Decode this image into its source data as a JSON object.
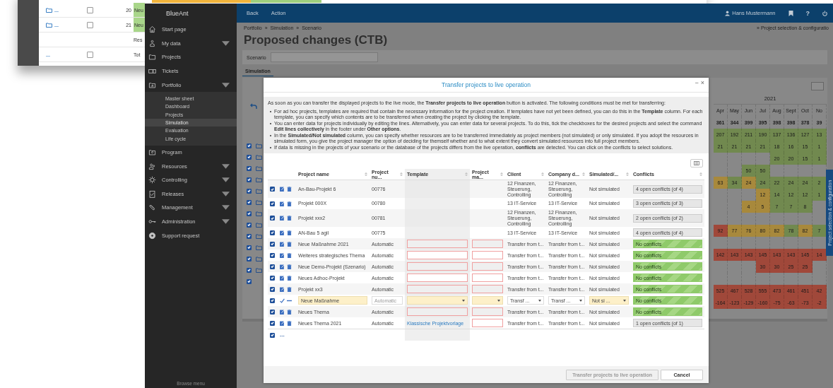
{
  "background_window": {
    "rows": [
      {
        "more": "...",
        "checked": false,
        "number": "20",
        "name": "Neu"
      },
      {
        "more": "...",
        "checked": false,
        "number": "21",
        "name": "Neu"
      }
    ],
    "result_label": "Res",
    "total": {
      "more": "...",
      "checked": false,
      "label": "Tot"
    }
  },
  "sidebar": {
    "logo": "BlueAnt",
    "items": [
      {
        "label": "Start page",
        "expandable": false
      },
      {
        "label": "My data",
        "expandable": true
      },
      {
        "label": "Projects",
        "expandable": false
      },
      {
        "label": "Tickets",
        "expandable": false
      },
      {
        "label": "Portfolio",
        "expandable": true,
        "children": [
          {
            "label": "Master sheet",
            "selected": false
          },
          {
            "label": "Dashboard",
            "selected": false
          },
          {
            "label": "Projects",
            "selected": false
          },
          {
            "label": "Simulation",
            "selected": true
          },
          {
            "label": "Evaluation",
            "selected": false
          },
          {
            "label": "Life cycle",
            "selected": false
          }
        ]
      },
      {
        "label": "Program",
        "expandable": false
      },
      {
        "label": "Resources",
        "expandable": true
      },
      {
        "label": "Controlling",
        "expandable": true
      },
      {
        "label": "Releases",
        "expandable": true
      },
      {
        "label": "Management",
        "expandable": true
      },
      {
        "label": "Administration",
        "expandable": true
      },
      {
        "label": "Support request",
        "expandable": false
      }
    ],
    "footer": "Browse menu"
  },
  "topbar": {
    "buttons": [
      "Back",
      "Action"
    ],
    "user": "Hans Mustermann",
    "help": "?"
  },
  "breadcrumb": {
    "items": [
      "Portfolio",
      "Simulation",
      "Scenario"
    ],
    "separator": "»"
  },
  "config_link": "» Project selection & configuratio",
  "title": "Proposed changes (CTB)",
  "filter": {
    "label": "Scenario"
  },
  "tabs": [
    {
      "label": "Simulation",
      "selected": true
    }
  ],
  "side_tab": "Project selection & configuration",
  "grid": {
    "rows": [
      {
        "checked": true
      },
      {
        "checked": true
      },
      {
        "checked": true
      },
      {
        "checked": true
      },
      {
        "checked": true
      },
      {
        "checked": true
      },
      {
        "checked": true
      },
      {
        "checked": true
      },
      {
        "checked": true
      },
      {
        "checked": true
      },
      {
        "checked": true
      },
      {
        "checked": true
      }
    ],
    "footer": {
      "checked": true
    }
  },
  "calendar": {
    "year": "2021",
    "months": [
      "Apr",
      "May",
      "Jun",
      "Jul",
      "Aug",
      "Sept",
      "Oct",
      "No"
    ],
    "rows": [
      [
        {
          "text": "361"
        },
        {
          "text": "344"
        },
        {
          "text": "399"
        },
        {
          "text": "395"
        },
        {
          "text": "398"
        },
        {
          "text": "398"
        },
        {
          "text": "378"
        },
        {
          "text": "39"
        }
      ],
      [
        {
          "text": "207",
          "color": "#71894f"
        },
        {
          "text": "192",
          "color": "#71894f"
        },
        {
          "text": "211",
          "color": "#71894f"
        },
        {
          "text": "190",
          "color": "#71894f"
        },
        {
          "text": "137",
          "color": "#71894f"
        },
        {
          "text": "136",
          "color": "#71894f"
        },
        {
          "text": "127",
          "color": "#71894f"
        },
        {
          "text": "13",
          "color": "#71894f"
        }
      ],
      [
        {
          "text": "21",
          "color": "#71894f"
        },
        {
          "text": "21",
          "color": "#71894f"
        },
        {
          "text": "21",
          "color": "#71894f"
        },
        {
          "text": "21",
          "color": "#71894f"
        },
        {
          "text": "18",
          "color": "#71894f"
        },
        {
          "text": "16",
          "color": "#71894f"
        },
        {
          "text": "15",
          "color": "#71894f"
        },
        {
          "text": "1",
          "color": "#71894f"
        }
      ],
      [
        null,
        null,
        null,
        null,
        {
          "text": "20",
          "color": "#71894f"
        },
        {
          "text": "20",
          "color": "#71894f"
        },
        {
          "text": "15",
          "color": "#71894f"
        },
        {
          "text": "1",
          "color": "#71894f"
        }
      ],
      [
        null,
        null,
        {
          "text": "50",
          "color": "#71894f"
        },
        {
          "text": "50",
          "color": "#71894f"
        },
        null,
        null,
        null,
        null
      ],
      [
        {
          "text": "63",
          "color": "#a8893c"
        },
        {
          "text": "34",
          "color": "#71894f"
        },
        {
          "text": "24",
          "color": "#a8893c"
        },
        {
          "text": "24",
          "color": "#71894f"
        },
        {
          "text": "22",
          "color": "#71894f"
        },
        {
          "text": "24",
          "color": "#71894f"
        },
        {
          "text": "24",
          "color": "#71894f"
        },
        {
          "text": "2",
          "color": "#71894f"
        }
      ],
      [
        null,
        null,
        null,
        {
          "text": "12",
          "color": "#a8893c"
        },
        {
          "text": "14",
          "color": "#71894f"
        },
        {
          "text": "12",
          "color": "#71894f"
        },
        {
          "text": "12",
          "color": "#71894f"
        },
        {
          "text": "1",
          "color": "#71894f"
        }
      ],
      [
        null,
        null,
        {
          "text": "4",
          "color": "#a8893c"
        },
        {
          "text": "5",
          "color": "#a8893c"
        },
        {
          "text": "7",
          "color": "#71894f"
        },
        {
          "text": "7",
          "color": "#71894f"
        },
        {
          "text": "8",
          "color": "#71894f"
        },
        null
      ],
      [
        null,
        null,
        null,
        null,
        null,
        null,
        null,
        null
      ],
      [
        {
          "text": "92",
          "color": "#a0483a"
        },
        {
          "text": "77",
          "color": "#a8893c"
        },
        {
          "text": "76",
          "color": "#a8893c"
        },
        {
          "text": "80",
          "color": "#a8893c"
        },
        {
          "text": "82",
          "color": "#a8893c"
        },
        {
          "text": "78",
          "color": "#71894f"
        },
        {
          "text": "82",
          "color": "#a8893c"
        },
        {
          "text": "7",
          "color": "#71894f"
        }
      ],
      [
        null,
        null,
        null,
        null,
        null,
        null,
        null,
        null
      ],
      [
        {
          "text": "142",
          "color": "#a0483a"
        },
        {
          "text": "143",
          "color": "#a0483a"
        },
        {
          "text": "143",
          "color": "#a0483a"
        },
        {
          "text": "145",
          "color": "#a0483a"
        },
        {
          "text": "143",
          "color": "#a0483a"
        },
        {
          "text": "143",
          "color": "#a0483a"
        },
        {
          "text": "145",
          "color": "#a0483a"
        },
        {
          "text": "14",
          "color": "#a0483a"
        }
      ],
      [
        null,
        null,
        null,
        {
          "text": "30",
          "color": "#a0483a"
        },
        {
          "text": "30",
          "color": "#a0483a"
        },
        {
          "text": "25",
          "color": "#a0483a"
        },
        {
          "text": "25",
          "color": "#a0483a"
        },
        null
      ],
      [
        null,
        null,
        null,
        null,
        null,
        null,
        null,
        null
      ],
      [
        {
          "text": "525",
          "color": "#a0483a"
        },
        {
          "text": "467",
          "color": "#a0483a"
        },
        {
          "text": "528",
          "color": "#a0483a"
        },
        {
          "text": "555",
          "color": "#a0483a"
        },
        {
          "text": "473",
          "color": "#a0483a"
        },
        {
          "text": "461",
          "color": "#a0483a"
        },
        {
          "text": "451",
          "color": "#a0483a"
        },
        {
          "text": "42",
          "color": "#a0483a"
        }
      ],
      [
        {
          "text": "-164",
          "color": "#a0483a"
        },
        {
          "text": "-123",
          "color": "#a0483a"
        },
        {
          "text": "-129",
          "color": "#a0483a"
        },
        {
          "text": "-160",
          "color": "#a0483a"
        },
        {
          "text": "-75",
          "color": "#a0483a"
        },
        {
          "text": "-63",
          "color": "#a0483a"
        },
        {
          "text": "-73",
          "color": "#a0483a"
        },
        {
          "text": "-2",
          "color": "#a0483a"
        }
      ]
    ]
  },
  "dialog": {
    "title": "Transfer projects to live operation",
    "minimize": "−",
    "close": "×",
    "intro": "As soon as you can transfer the displayed projects to the live mode, the **Transfer projects to live operation** button is activated. The following conditions must be met for transferring:",
    "bullets": [
      "For ad hoc projects, templates are required that contain the necessary information for the project creation. If templates have not yet been defined, you can do this in the **Template** column. For each template, you can specify which contents are to be transferred when creating the project by clicking the template.",
      "You can enter data for projects individually by editing the lines. Alternatively, you can enter data for several projects. To do this, tick the checkboxes for the desired projects and select the command **Edit lines collectively** in the footer under **Other options**.",
      "In the **Simulated/Not simulated** column, you can specify whether resources are to be transferred immediately as project members (not simulated) or only simulated. If you adopt the resources in simulated form, you give the project manager the option of deciding for themself whether and to what extent they convert simulated resources into full project members.",
      "If data is missing in the projects of your scenario or the database of the projects differs from the live operation, **conflicts** are detected. You can click on the conflicts to select solutions."
    ],
    "columns": [
      "Project name",
      "Project nu...",
      "Template",
      "Project ma...",
      "Client",
      "Company d...",
      "Simulated/...",
      "Conflicts"
    ],
    "rows": [
      {
        "kind": "view",
        "checked": true,
        "name": "An-Bau-Projekt 6",
        "number": "00776",
        "template_missing": false,
        "manager_missing": false,
        "client": "12 Finanzen, Steuerung, Controlling",
        "company": "12 Finanzen, Steuerung, Controlling",
        "simulated": "Not simulated",
        "conflicts": "4 open conflicts (of 4)",
        "resolved": false
      },
      {
        "kind": "view",
        "checked": true,
        "name": "Projekt 000X",
        "number": "00780",
        "template_missing": false,
        "manager_missing": false,
        "client": "13 IT-Service",
        "company": "13 IT-Service",
        "simulated": "Not simulated",
        "conflicts": "3 open conflicts (of 3)",
        "resolved": false
      },
      {
        "kind": "view",
        "checked": true,
        "name": "Projekt xxx2",
        "number": "00781",
        "template_missing": false,
        "manager_missing": false,
        "client": "12 Finanzen, Steuerung, Controlling",
        "company": "12 Finanzen, Steuerung, Controlling",
        "simulated": "Not simulated",
        "conflicts": "2 open conflicts (of 2)",
        "resolved": false
      },
      {
        "kind": "view",
        "checked": true,
        "name": "AN-Bau 5 agil",
        "number": "00775",
        "template_missing": false,
        "manager_missing": false,
        "client": "13 IT-Service",
        "company": "13 IT-Service",
        "simulated": "Not simulated",
        "conflicts": "4 open conflicts (of 4)",
        "resolved": false
      },
      {
        "kind": "view",
        "checked": true,
        "name": "Neue Maßnahme 2021",
        "number": "Automatic",
        "template_missing": true,
        "manager_missing": true,
        "client": "Transfer from t...",
        "company": "Transfer from t...",
        "simulated": "Not simulated",
        "conflicts": "No conflicts",
        "resolved": true
      },
      {
        "kind": "view",
        "checked": true,
        "name": "Weiteres strategisches Thema",
        "number": "Automatic",
        "template_missing": true,
        "manager_missing": true,
        "client": "Transfer from t...",
        "company": "Transfer from t...",
        "simulated": "Not simulated",
        "conflicts": "No conflicts",
        "resolved": true
      },
      {
        "kind": "view",
        "checked": true,
        "name": "Neue Demo-Projekt (Szenario)",
        "number": "Automatic",
        "template_missing": true,
        "manager_missing": true,
        "client": "Transfer from t...",
        "company": "Transfer from t...",
        "simulated": "Not simulated",
        "conflicts": "No conflicts",
        "resolved": true
      },
      {
        "kind": "view",
        "checked": true,
        "name": "Neues Adhoc-Projekt",
        "number": "Automatic",
        "template_missing": true,
        "manager_missing": true,
        "client": "Transfer from t...",
        "company": "Transfer from t...",
        "simulated": "Not simulated",
        "conflicts": "No conflicts",
        "resolved": true
      },
      {
        "kind": "view",
        "checked": true,
        "name": "Projekt xx3",
        "number": "Automatic",
        "template_missing": true,
        "manager_missing": true,
        "client": "Transfer from t...",
        "company": "Transfer from t...",
        "simulated": "Not simulated",
        "conflicts": "No conflicts",
        "resolved": true
      },
      {
        "kind": "edit",
        "checked": true,
        "name": "Neue Maßnahme",
        "number_placeholder": "Automatic",
        "client": "Transf ...",
        "company": "Transf ...",
        "simulated": "Not si ...",
        "conflicts": "No conflicts",
        "resolved": true
      },
      {
        "kind": "view",
        "checked": true,
        "name": "Neues Thema",
        "number": "Automatic",
        "template_missing": true,
        "manager_missing": true,
        "client": "Transfer from t...",
        "company": "Transfer from t...",
        "simulated": "Not simulated",
        "conflicts": "No conflicts",
        "resolved": true
      },
      {
        "kind": "view",
        "checked": true,
        "name": "Neues Thema 2021",
        "number": "Automatic",
        "template": "Klassische Projektvorlage",
        "template_missing": false,
        "manager_missing": true,
        "client": "Transfer from t...",
        "company": "Transfer from t...",
        "simulated": "Not simulated",
        "conflicts": "1 open conflicts (of 1)",
        "resolved": false
      }
    ],
    "footer_row": {
      "checked": true,
      "more": "..."
    },
    "buttons": [
      {
        "label": "Transfer projects to live operation",
        "disabled": true
      },
      {
        "label": "Cancel",
        "disabled": false
      }
    ]
  }
}
